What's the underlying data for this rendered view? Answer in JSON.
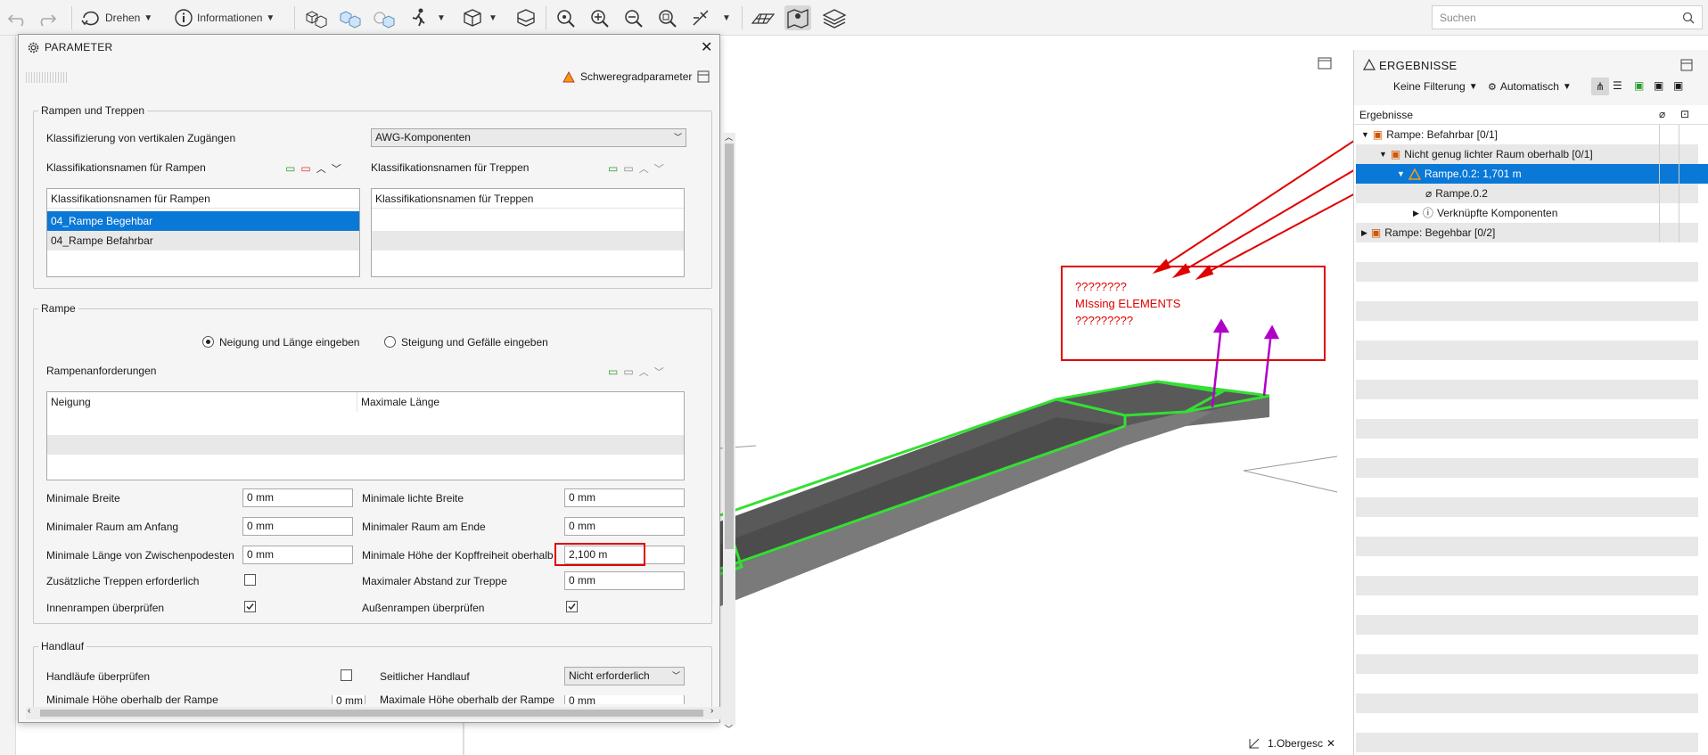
{
  "toolbar": {
    "rotate_label": "Drehen",
    "info_label": "Informationen",
    "search_placeholder": "Suchen"
  },
  "dialog": {
    "title": "PARAMETER",
    "severity_link": "Schweregradparameter",
    "ramps_stairs": {
      "legend": "Rampen und Treppen",
      "classification_label": "Klassifizierung von vertikalen Zugängen",
      "classification_value": "AWG-Komponenten",
      "ramp_names_label": "Klassifikationsnamen für Rampen",
      "stair_names_label": "Klassifikationsnamen für Treppen",
      "ramp_table_header": "Klassifikationsnamen für Rampen",
      "ramp_rows": [
        "04_Rampe Begehbar",
        "04_Rampe Befahrbar"
      ],
      "stair_table_header": "Klassifikationsnamen für Treppen"
    },
    "ramp": {
      "legend": "Rampe",
      "radio_1": "Neigung und Länge eingeben",
      "radio_2": "Steigung und Gefälle eingeben",
      "requirements_label": "Rampenanforderungen",
      "col_slope": "Neigung",
      "col_maxlen": "Maximale Länge",
      "min_width_label": "Minimale Breite",
      "min_width": "0 mm",
      "min_clear_width_label": "Minimale lichte Breite",
      "min_clear_width": "0 mm",
      "min_space_start_label": "Minimaler Raum am Anfang",
      "min_space_start": "0 mm",
      "min_space_end_label": "Minimaler Raum am Ende",
      "min_space_end": "0 mm",
      "min_landing_label": "Minimale Länge von Zwischenpodesten",
      "min_landing": "0 mm",
      "min_headroom_label": "Minimale Höhe der Kopffreiheit oberhalb",
      "min_headroom": "2,100 m",
      "extra_stairs_label": "Zusätzliche Treppen erforderlich",
      "max_dist_label": "Maximaler Abstand zur Treppe",
      "max_dist": "0 mm",
      "inner_label": "Innenrampen überprüfen",
      "outer_label": "Außenrampen überprüfen"
    },
    "handrail": {
      "legend": "Handlauf",
      "check_label": "Handläufe überprüfen",
      "side_label": "Seitlicher Handlauf",
      "side_value": "Nicht erforderlich",
      "min_height_label": "Minimale Höhe oberhalb der Rampe",
      "min_height": "0 mm",
      "max_height_label": "Maximale Höhe oberhalb der Rampe",
      "max_height": "0 mm"
    }
  },
  "annotation": {
    "line1": "????????",
    "line2": "MIssing ELEMENTS",
    "line3": "?????????"
  },
  "results": {
    "title": "ERGEBNISSE",
    "filter": "Keine Filterung",
    "mode": "Automatisch",
    "column": "Ergebnisse",
    "rows": [
      "Rampe: Befahrbar [0/1]",
      "Nicht genug lichter Raum oberhalb [0/1]",
      "Rampe.0.2: 1,701 m",
      "Rampe.0.2",
      "Verknüpfte Komponenten",
      "Rampe: Begehbar [0/2]"
    ]
  },
  "storey_label": "1.Obergesc",
  "colors": {
    "accent": "#0a78d7",
    "annotation": "#e00000",
    "highlight": "#33e033",
    "measure": "#b000c8"
  }
}
